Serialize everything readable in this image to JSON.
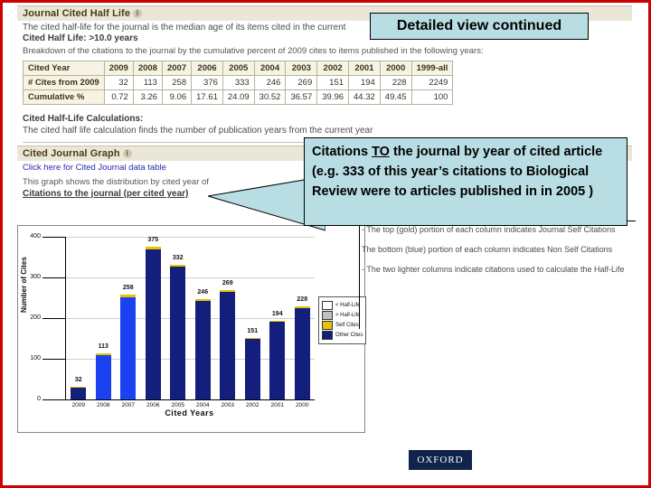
{
  "slide": {
    "callout_title": "Detailed view continued",
    "callout_body_parts": {
      "p1": "Citations ",
      "p2": "TO",
      "p3": " the journal by year of cited article  (e.g. 333 of this year’s citations to Biological Review were to articles published in in 2005 )"
    },
    "footer_logo": "OXFORD"
  },
  "jcr": {
    "section1_title": "Journal Cited Half Life",
    "section1_info_icon": "i",
    "section1_desc": "The cited half-life for the journal is the median age of its items cited in the current",
    "section1_value": "Cited Half Life: >10.0 years",
    "breakdown_note": "Breakdown of the citations to the journal by the cumulative percent of 2009 cites to items published in the following years:",
    "calc_title": "Cited Half-Life Calculations:",
    "calc_desc": "The cited half life calculation finds the number of publication years from the current year",
    "section2_title": "Cited Journal Graph",
    "section2_info_icon": "i",
    "data_table_link": "Click here for Cited Journal data table",
    "graph_desc": "This graph shows the distribution by cited year of",
    "graph_subtitle": "Citations to the journal (per cited year)",
    "right_notes": [
      "- The top (gold) portion of each column indicates Journal Self Citations",
      "   The bottom (blue) portion of each column indicates Non Self Citations",
      "- The two lighter columns indicate citations used to calculate the Half-Life"
    ]
  },
  "cited_year_table": {
    "columns": [
      "Cited Year",
      "2009",
      "2008",
      "2007",
      "2006",
      "2005",
      "2004",
      "2003",
      "2002",
      "2001",
      "2000",
      "1999-all"
    ],
    "rows": [
      {
        "label": "# Cites from 2009",
        "values": [
          "32",
          "113",
          "258",
          "376",
          "333",
          "246",
          "269",
          "151",
          "194",
          "228",
          "2249"
        ]
      },
      {
        "label": "Cumulative %",
        "values": [
          "0.72",
          "3.26",
          "9.06",
          "17.61",
          "24.09",
          "30.52",
          "36.57",
          "39.96",
          "44.32",
          "49.45",
          "100"
        ]
      }
    ]
  },
  "chart_data": {
    "type": "bar",
    "title": "Citations to the journal (per cited year)",
    "xlabel": "Cited Years",
    "ylabel": "Number of Cites",
    "categories": [
      "2009",
      "2008",
      "2007",
      "2006",
      "2005",
      "2004",
      "2003",
      "2002",
      "2001",
      "2000"
    ],
    "values": [
      32,
      113,
      258,
      376,
      332,
      246,
      269,
      151,
      194,
      228
    ],
    "value_labels": [
      "32",
      "113",
      "258",
      "375",
      "332",
      "246",
      "269",
      "151",
      "194",
      "228"
    ],
    "self_cites": [
      2,
      4,
      6,
      8,
      6,
      4,
      4,
      3,
      3,
      4
    ],
    "highlighted": [
      false,
      true,
      true,
      false,
      false,
      false,
      false,
      false,
      false,
      false
    ],
    "ylim": [
      0,
      400
    ],
    "yticks": [
      "0",
      "100",
      "200",
      "300",
      "400"
    ],
    "grid": true,
    "legend_position": "right",
    "legend": [
      {
        "label": "< Half-Life",
        "color": "#ffffff"
      },
      {
        "label": "> Half-Life",
        "color": "#c0c0c0"
      },
      {
        "label": "Self Cites",
        "color": "#e8c200"
      },
      {
        "label": "Other Cites",
        "color": "#141e7c"
      }
    ]
  }
}
